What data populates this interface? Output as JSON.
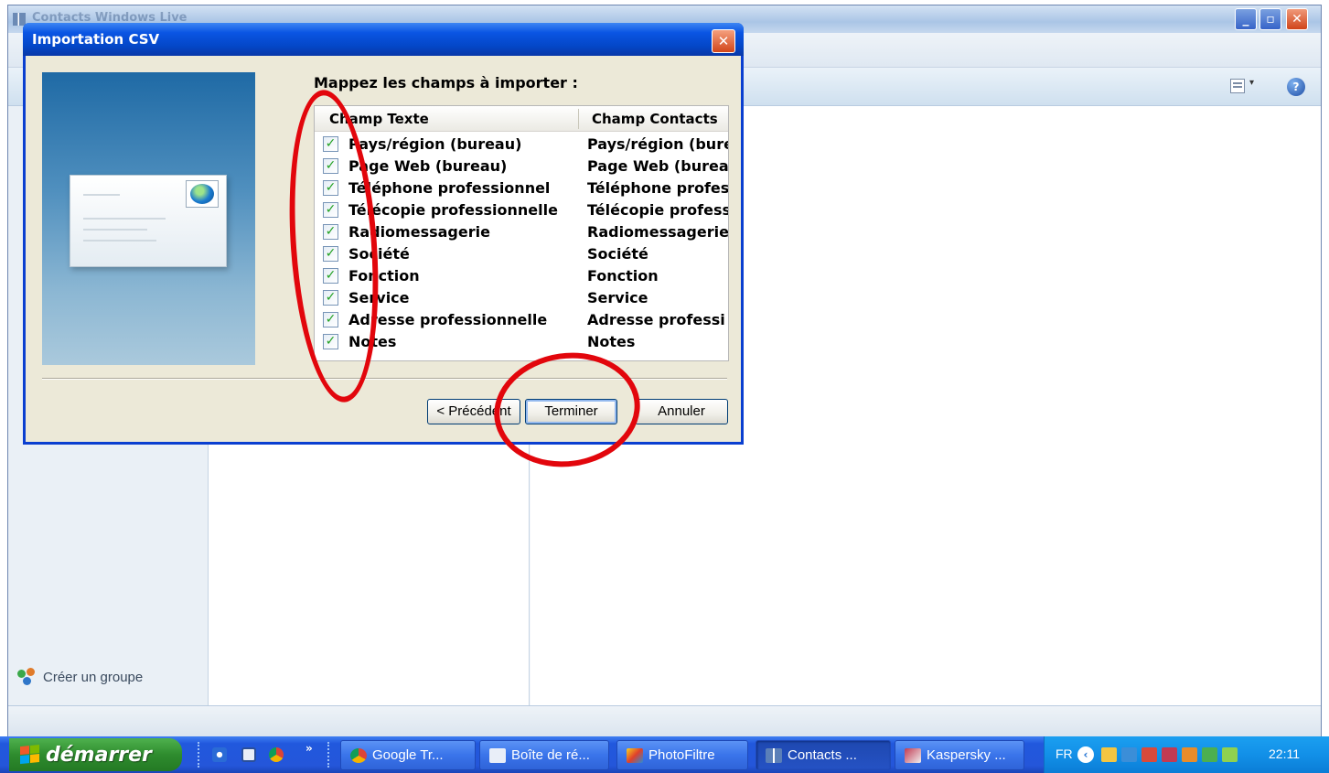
{
  "main_window": {
    "title": "Contacts Windows Live",
    "toolbar": {
      "help_icon": "?"
    },
    "sidebar": {
      "create_group_label": "Créer un groupe"
    }
  },
  "dialog": {
    "title": "Importation CSV",
    "heading": "Mappez les champs à importer :",
    "columns": {
      "source": "Champ Texte",
      "target": "Champ Contacts"
    },
    "rows": [
      {
        "source": "Pays/région (bureau)",
        "target": "Pays/région (bure",
        "checked": true
      },
      {
        "source": "Page Web (bureau)",
        "target": "Page Web (burea",
        "checked": true
      },
      {
        "source": "Téléphone professionnel",
        "target": "Téléphone profes",
        "checked": true
      },
      {
        "source": "Télécopie professionnelle",
        "target": "Télécopie profess",
        "checked": true
      },
      {
        "source": "Radiomessagerie",
        "target": "Radiomessagerie",
        "checked": true
      },
      {
        "source": "Société",
        "target": "Société",
        "checked": true
      },
      {
        "source": "Fonction",
        "target": "Fonction",
        "checked": true
      },
      {
        "source": "Service",
        "target": "Service",
        "checked": true
      },
      {
        "source": "Adresse professionnelle",
        "target": "Adresse professi",
        "checked": true
      },
      {
        "source": "Notes",
        "target": "Notes",
        "checked": true
      }
    ],
    "buttons": {
      "previous": "< Précédent",
      "finish": "Terminer",
      "cancel": "Annuler"
    },
    "close_glyph": "✕"
  },
  "annotation_color": "#e2060c",
  "taskbar": {
    "start_label": "démarrer",
    "tasks": [
      {
        "label": "Google Tr...",
        "icon": "chrome-icon"
      },
      {
        "label": "Boîte de ré...",
        "icon": "mail-icon"
      },
      {
        "label": "PhotoFiltre",
        "icon": "photofiltre-icon"
      },
      {
        "label": "Contacts ...",
        "icon": "contacts-icon",
        "active": true
      },
      {
        "label": "Kaspersky ...",
        "icon": "kaspersky-icon"
      }
    ],
    "tray": {
      "language": "FR",
      "clock": "22:11"
    }
  }
}
